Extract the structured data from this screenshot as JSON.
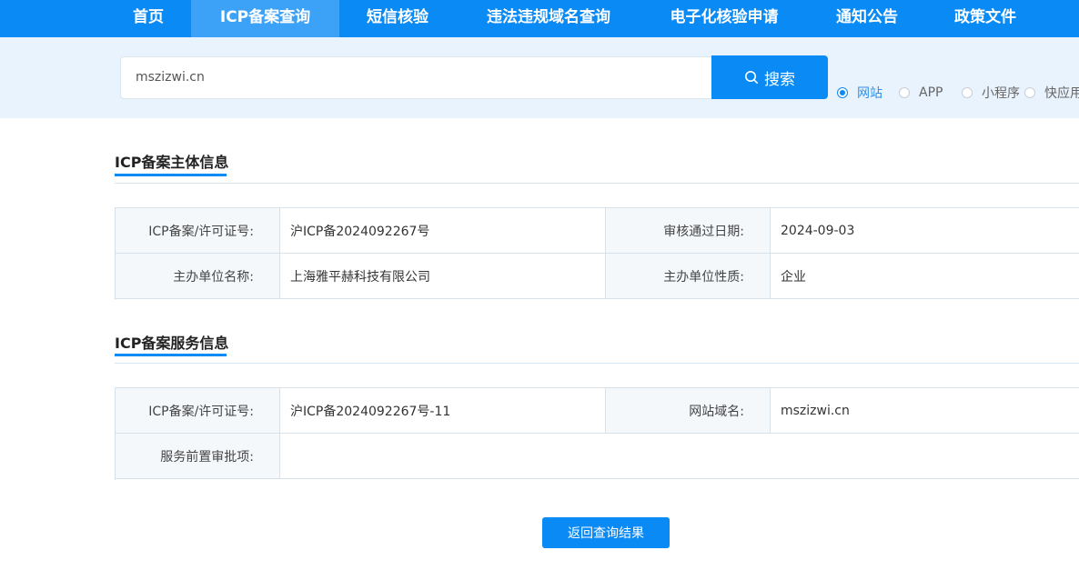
{
  "nav": {
    "items": [
      {
        "label": "首页"
      },
      {
        "label": "ICP备案查询"
      },
      {
        "label": "短信核验"
      },
      {
        "label": "违法违规域名查询"
      },
      {
        "label": "电子化核验申请"
      },
      {
        "label": "通知公告"
      },
      {
        "label": "政策文件"
      }
    ],
    "active": "ICP备案查询"
  },
  "search": {
    "value": "mszizwi.cn",
    "button_label": "搜索",
    "button_icon": "search-icon",
    "options": [
      {
        "label": "网站",
        "checked": true
      },
      {
        "label": "APP",
        "checked": false
      },
      {
        "label": "小程序",
        "checked": false
      },
      {
        "label": "快应用",
        "checked": false
      }
    ]
  },
  "subject_section": {
    "title": "ICP备案主体信息",
    "rows": [
      {
        "label1": "ICP备案/许可证号:",
        "value1": "沪ICP备2024092267号",
        "label2": "审核通过日期:",
        "value2": "2024-09-03"
      },
      {
        "label1": "主办单位名称:",
        "value1": "上海雅平赫科技有限公司",
        "label2": "主办单位性质:",
        "value2": "企业"
      }
    ]
  },
  "service_section": {
    "title": "ICP备案服务信息",
    "license_label": "ICP备案/许可证号:",
    "license_value": "沪ICP备2024092267号-11",
    "domain_label": "网站域名:",
    "domain_value": "mszizwi.cn",
    "approval_label": "服务前置审批项:",
    "approval_value": ""
  },
  "return_button_label": "返回查询结果",
  "colors": {
    "accent": "#0a8af5",
    "nav_active": "#3ca2f7",
    "search_band": "#e8f3fd"
  }
}
